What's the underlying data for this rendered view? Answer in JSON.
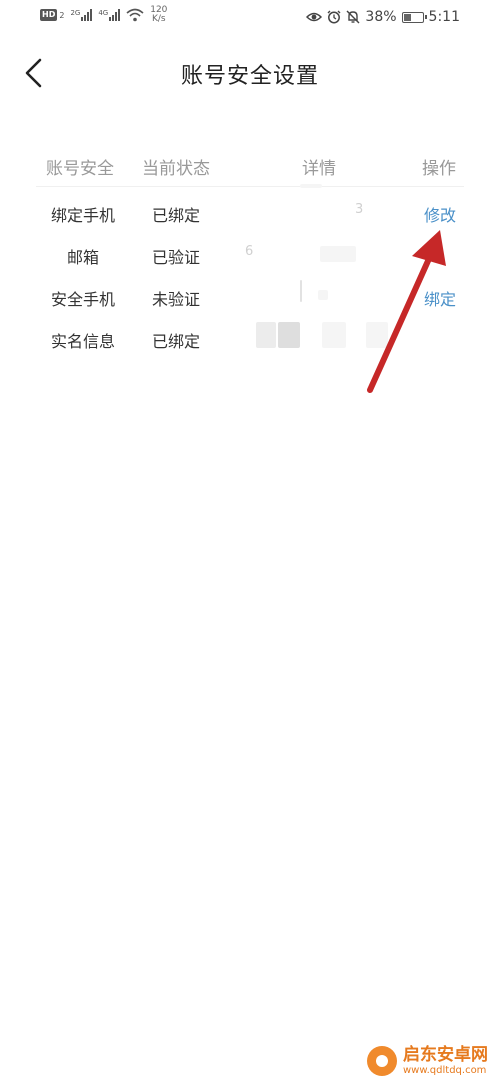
{
  "status_bar": {
    "hd_label": "HD",
    "hd_sub": "2",
    "net1": "2G",
    "net2": "4G",
    "speed_value": "120",
    "speed_unit": "K/s",
    "battery_percent": "38%",
    "battery_level": 0.38,
    "time": "5:11"
  },
  "header": {
    "title": "账号安全设置"
  },
  "table": {
    "columns": [
      "账号安全",
      "当前状态",
      "详情",
      "操作"
    ],
    "rows": [
      {
        "item": "绑定手机",
        "status": "已绑定",
        "detail": "3",
        "action": "修改"
      },
      {
        "item": "邮箱",
        "status": "已验证",
        "detail": "6",
        "action": ""
      },
      {
        "item": "安全手机",
        "status": "未验证",
        "detail": "",
        "action": "绑定"
      },
      {
        "item": "实名信息",
        "status": "已绑定",
        "detail": "",
        "action": ""
      }
    ]
  },
  "watermark": {
    "name": "启东安卓网",
    "url": "www.qdltdq.com"
  },
  "colors": {
    "link": "#4a90c8",
    "arrow": "#c62828",
    "watermark": "#e67a1e"
  }
}
